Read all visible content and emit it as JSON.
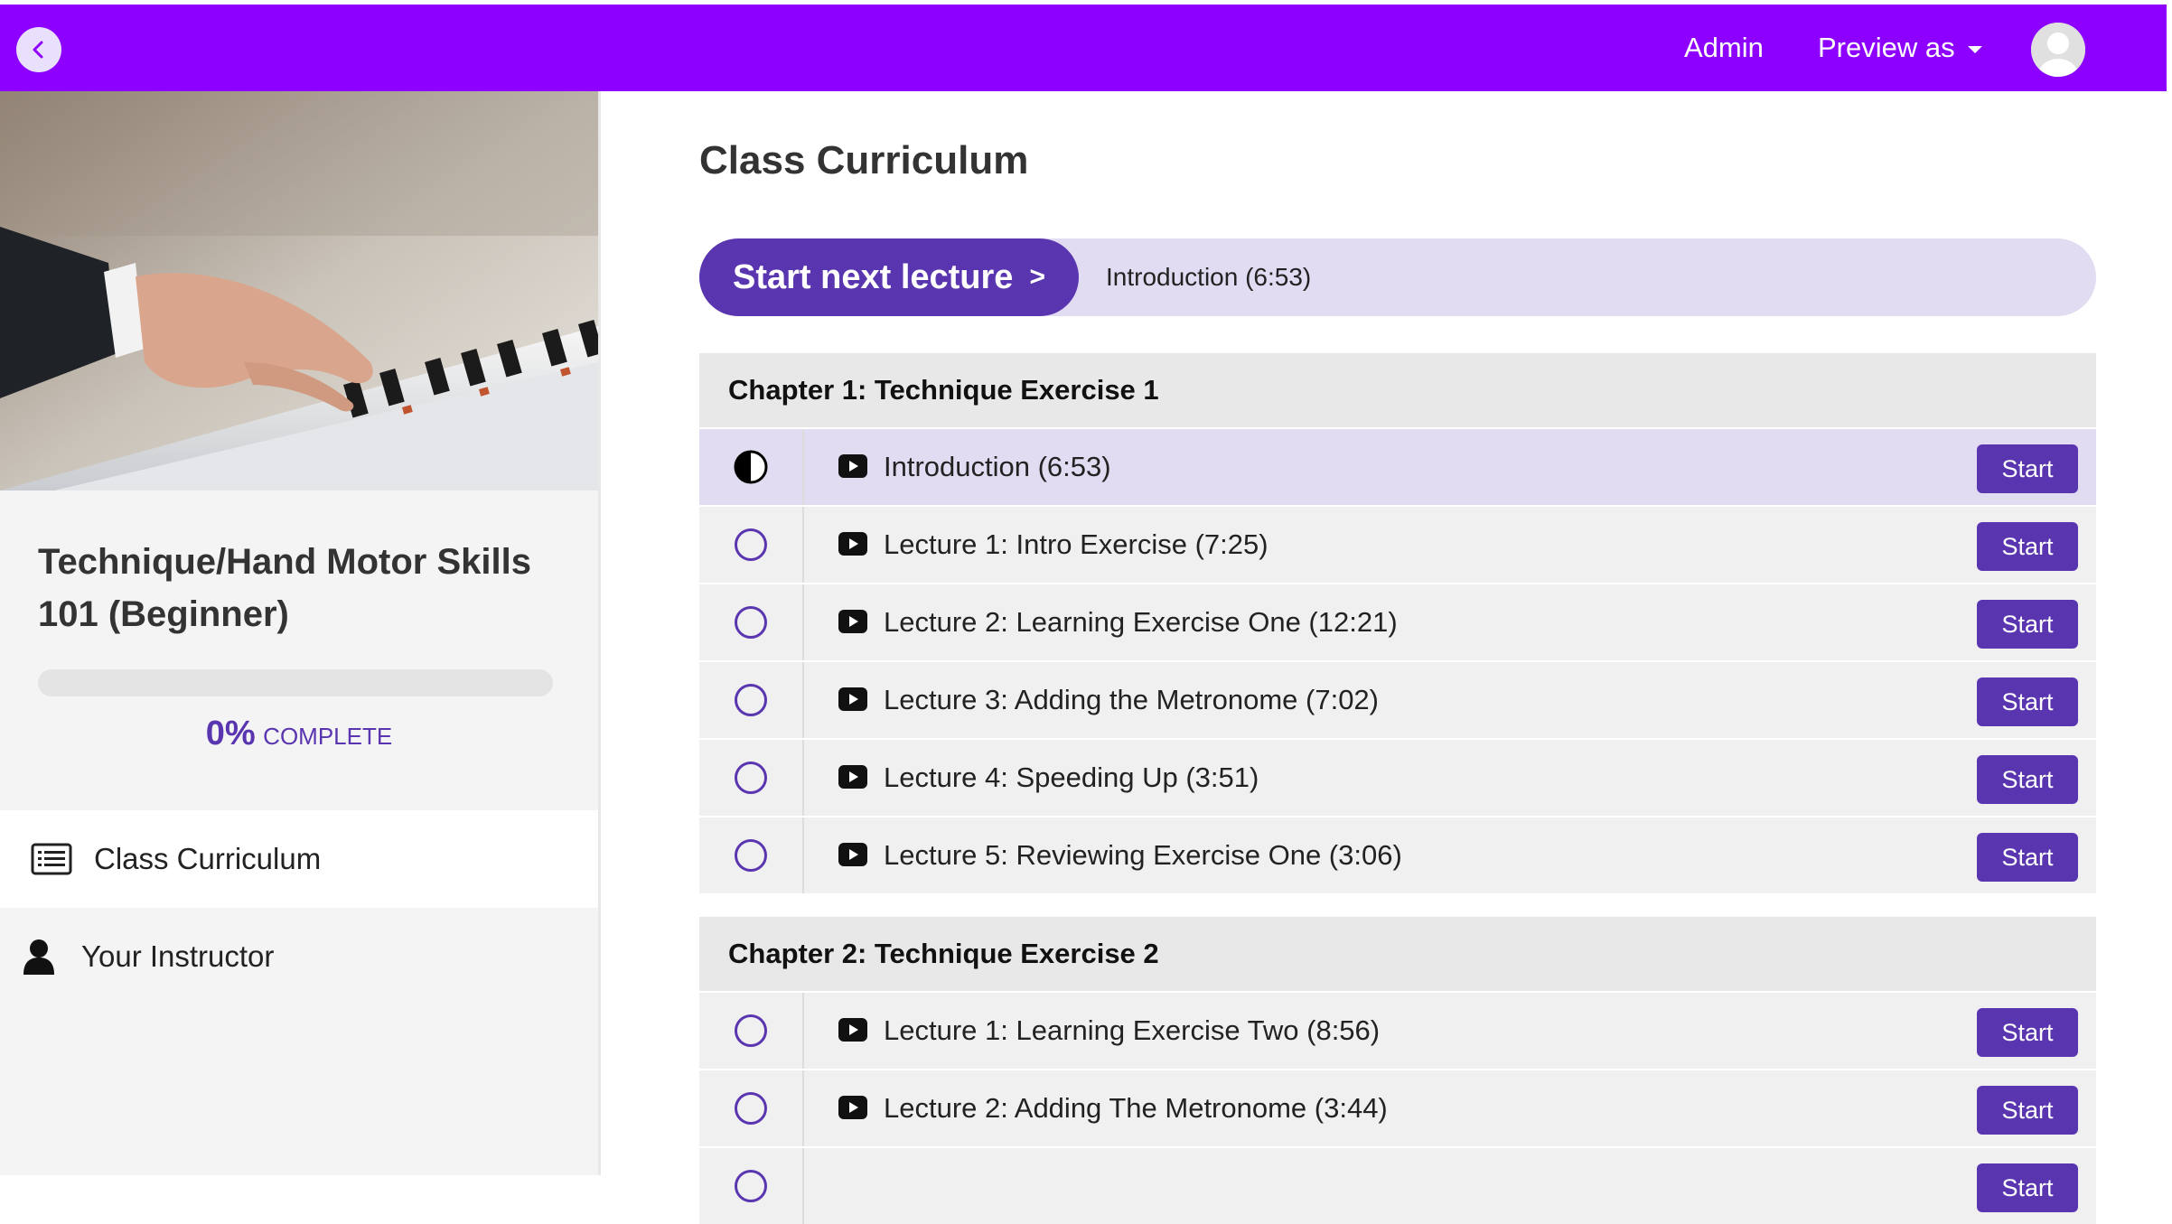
{
  "header": {
    "admin_label": "Admin",
    "preview_label": "Preview as",
    "accent_color": "#8d00ff"
  },
  "course": {
    "title": "Technique/Hand Motor Skills 101 (Beginner)",
    "progress_percent": 0,
    "progress_value": "0%",
    "progress_label": "COMPLETE"
  },
  "sidebar": {
    "items": [
      {
        "label": "Class Curriculum",
        "icon": "curriculum-list-icon",
        "active": true
      },
      {
        "label": "Your Instructor",
        "icon": "user-icon",
        "active": false
      }
    ]
  },
  "main": {
    "title": "Class Curriculum",
    "next_button_label": "Start next lecture",
    "next_button_arrow": ">",
    "next_lecture_title": "Introduction (6:53)",
    "start_label": "Start",
    "brand_color": "#5a35b0",
    "chapters": [
      {
        "title": "Chapter 1: Technique Exercise 1",
        "lectures": [
          {
            "title": "Introduction (6:53)",
            "status": "in-progress"
          },
          {
            "title": "Lecture 1: Intro Exercise (7:25)",
            "status": "not-started"
          },
          {
            "title": "Lecture 2: Learning Exercise One (12:21)",
            "status": "not-started"
          },
          {
            "title": "Lecture 3: Adding the Metronome (7:02)",
            "status": "not-started"
          },
          {
            "title": "Lecture 4: Speeding Up (3:51)",
            "status": "not-started"
          },
          {
            "title": "Lecture 5: Reviewing Exercise One (3:06)",
            "status": "not-started"
          }
        ]
      },
      {
        "title": "Chapter 2: Technique Exercise 2",
        "lectures": [
          {
            "title": "Lecture 1: Learning Exercise Two (8:56)",
            "status": "not-started"
          },
          {
            "title": "Lecture 2: Adding The Metronome (3:44)",
            "status": "not-started"
          }
        ]
      }
    ]
  }
}
